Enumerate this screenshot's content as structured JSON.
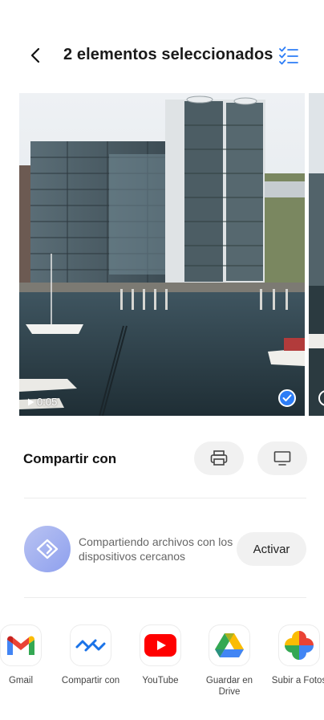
{
  "header": {
    "title": "2 elementos seleccionados",
    "back_icon": "back-chevron-icon",
    "select_icon": "checklist-icon"
  },
  "media": {
    "items": [
      {
        "duration": "0:05",
        "selected": true
      },
      {
        "duration": "",
        "selected": false
      }
    ]
  },
  "share": {
    "title": "Compartir con",
    "print_icon": "printer-icon",
    "cast_icon": "monitor-icon"
  },
  "nearby": {
    "description": "Compartiendo archivos con los dispositivos cercanos",
    "activate_label": "Activar"
  },
  "apps": [
    {
      "label": "Gmail"
    },
    {
      "label": "Compartir con"
    },
    {
      "label": "YouTube"
    },
    {
      "label": "Guardar en Drive"
    },
    {
      "label": "Subir a Fotos"
    }
  ],
  "colors": {
    "accent": "#2d7df6",
    "nearby_icon": "#8ea0ee",
    "button_bg": "#f1f1f1"
  }
}
